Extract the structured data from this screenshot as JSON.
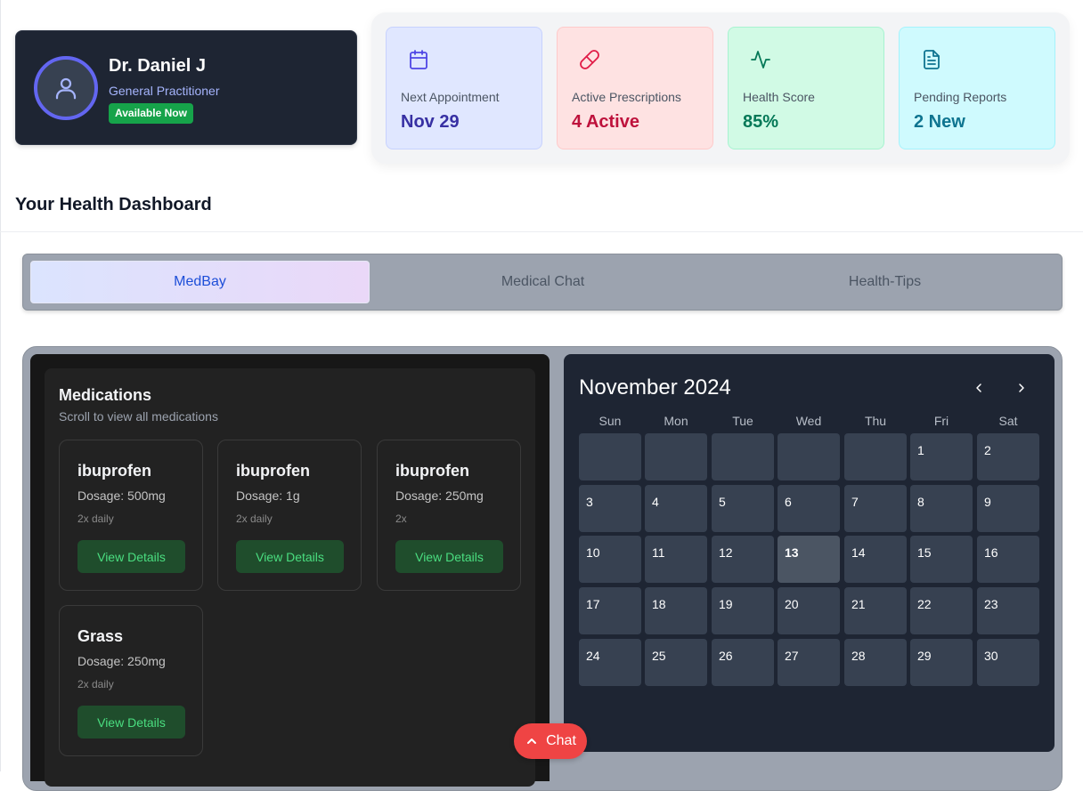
{
  "doctor": {
    "name": "Dr. Daniel J",
    "role": "General Practitioner",
    "status": "Available Now"
  },
  "stats": [
    {
      "label": "Next Appointment",
      "value": "Nov 29",
      "icon": "calendar-icon",
      "bg": "#e0e7ff",
      "border": "#c7d2fe",
      "color": "#3730a3",
      "icon_color": "#4f46e5"
    },
    {
      "label": "Active Prescriptions",
      "value": "4 Active",
      "icon": "pill-icon",
      "bg": "#fee2e2",
      "border": "#fecaca",
      "color": "#be123c",
      "icon_color": "#e11d48"
    },
    {
      "label": "Health Score",
      "value": "85%",
      "icon": "activity-icon",
      "bg": "#d1fae5",
      "border": "#a7f3d0",
      "color": "#047857",
      "icon_color": "#047857"
    },
    {
      "label": "Pending Reports",
      "value": "2 New",
      "icon": "file-text-icon",
      "bg": "#cffafe",
      "border": "#a5f3fc",
      "color": "#0e7490",
      "icon_color": "#0e7490"
    }
  ],
  "dashboard_title": "Your Health Dashboard",
  "tabs": [
    {
      "label": "MedBay",
      "active": true
    },
    {
      "label": "Medical Chat",
      "active": false
    },
    {
      "label": "Health-Tips",
      "active": false
    }
  ],
  "medications": {
    "title": "Medications",
    "subtitle": "Scroll to view all medications",
    "button_label": "View Details",
    "items": [
      {
        "name": "ibuprofen",
        "dosage": "Dosage: 500mg",
        "frequency": "2x daily"
      },
      {
        "name": "ibuprofen",
        "dosage": "Dosage: 1g",
        "frequency": "2x daily"
      },
      {
        "name": "ibuprofen",
        "dosage": "Dosage: 250mg",
        "frequency": "2x"
      },
      {
        "name": "Grass",
        "dosage": "Dosage: 250mg",
        "frequency": "2x daily"
      }
    ]
  },
  "calendar": {
    "month_label": "November 2024",
    "weekdays": [
      "Sun",
      "Mon",
      "Tue",
      "Wed",
      "Thu",
      "Fri",
      "Sat"
    ],
    "first_weekday_index": 5,
    "days_in_month": 30,
    "today": 13
  },
  "chat_fab": {
    "label": "Chat"
  }
}
